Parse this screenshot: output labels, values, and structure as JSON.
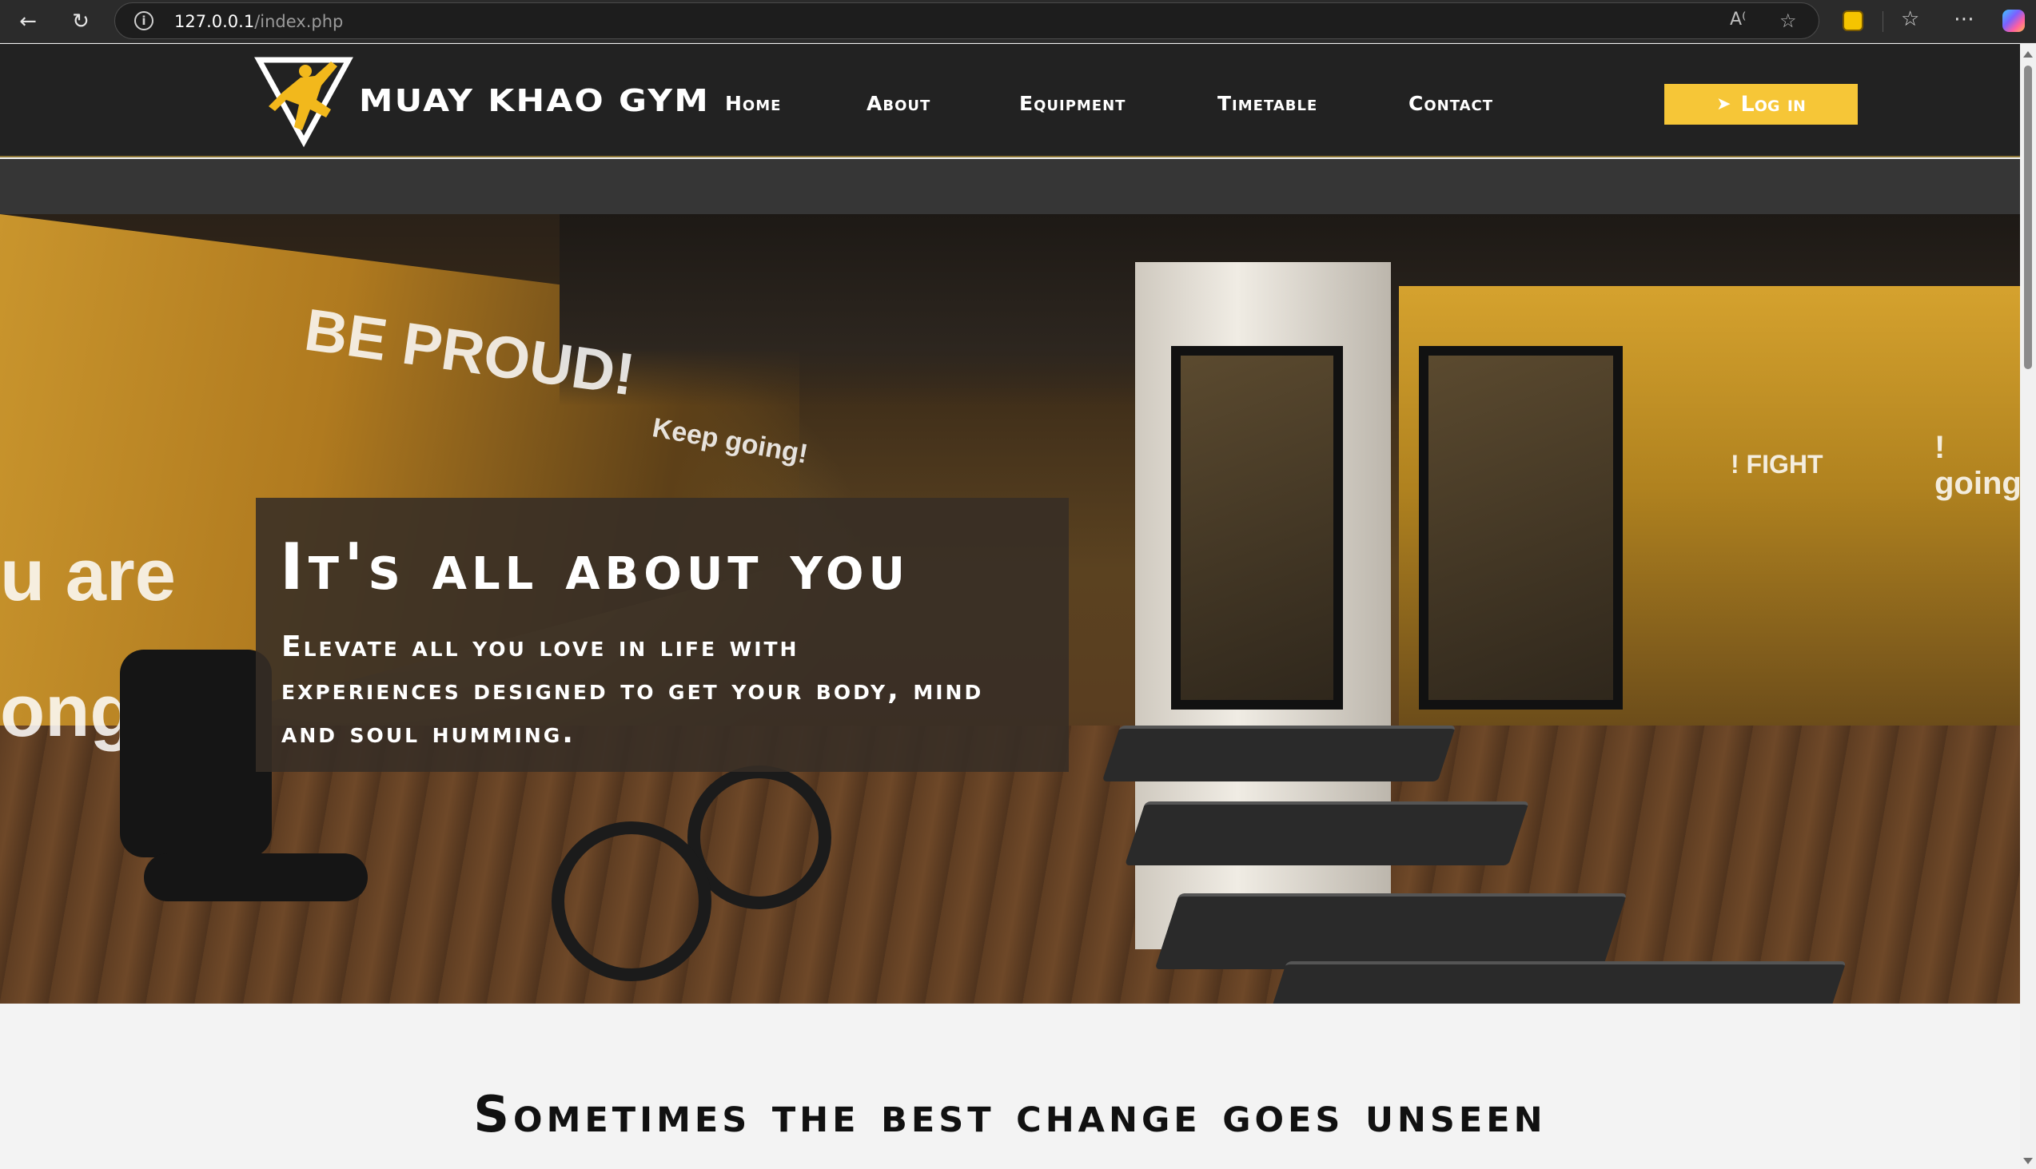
{
  "browser": {
    "url_host": "127.0.0.1",
    "url_path": "/index.php"
  },
  "site": {
    "brand_name": "MUAY KHAO GYM",
    "nav": [
      {
        "label": "Home"
      },
      {
        "label": "About"
      },
      {
        "label": "Equipment"
      },
      {
        "label": "Timetable"
      },
      {
        "label": "Contact"
      }
    ],
    "login_label": "Log in",
    "accent_color": "#f6c637"
  },
  "hero": {
    "title": "It's all about you",
    "subtitle": "Elevate all you love in life with experiences designed to get your body, mind and soul humming.",
    "wall_text": {
      "be_proud": "BE PROUD!",
      "keep_going": "Keep going!",
      "you_are": "u are",
      "strong": "ong",
      "fight": "! FIGHT",
      "going_mirror": "! going"
    }
  },
  "section": {
    "title": "Sometimes the best change goes unseen"
  }
}
